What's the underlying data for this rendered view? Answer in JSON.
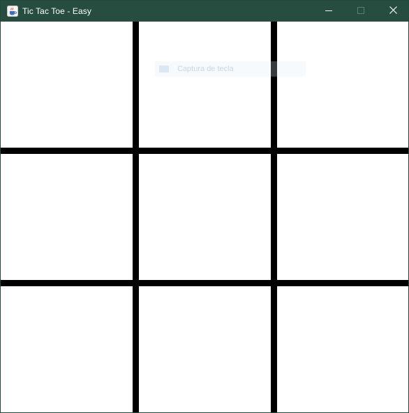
{
  "window": {
    "title": "Tic Tac Toe - Easy",
    "app_icon": "java-cup-icon",
    "titlebar_color": "#264d40",
    "controls": {
      "minimize": "minimize-icon",
      "maximize": "maximize-icon",
      "close": "close-icon"
    }
  },
  "board": {
    "rows": 3,
    "columns": 3,
    "grid_color": "#000000",
    "cell_color": "#ffffff",
    "cells": [
      [
        "",
        "",
        ""
      ],
      [
        "",
        "",
        ""
      ],
      [
        "",
        "",
        ""
      ]
    ]
  },
  "overlay_toast": {
    "text": "Captura de tecla",
    "icon": "keyboard-icon"
  }
}
